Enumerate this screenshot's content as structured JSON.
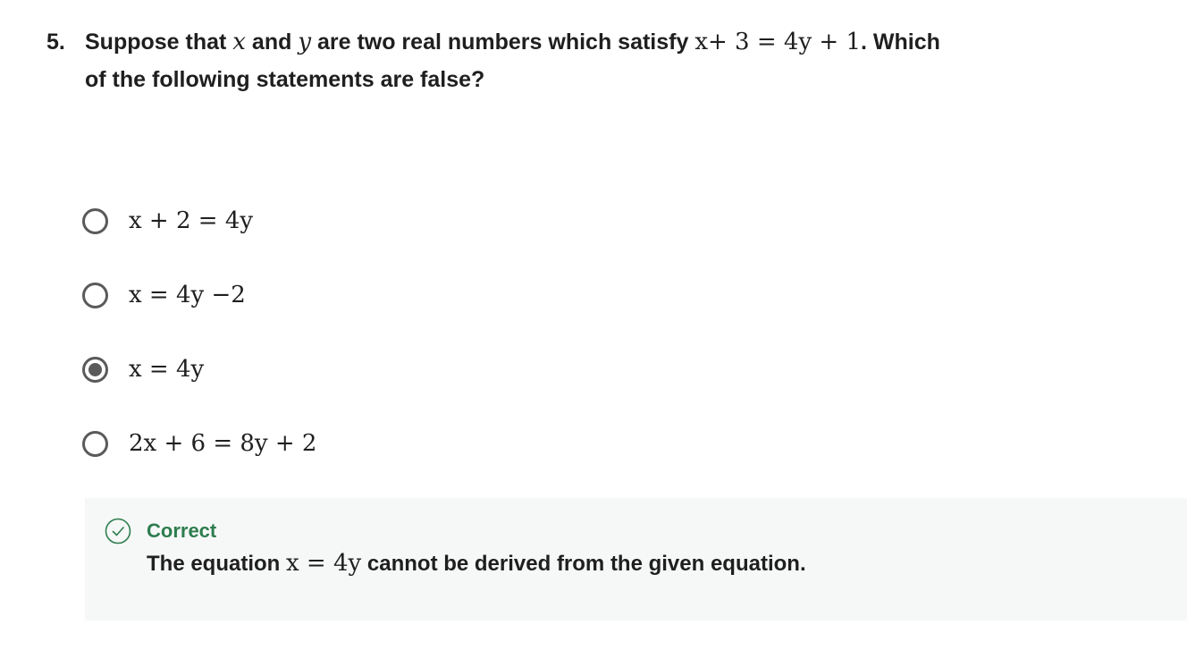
{
  "question": {
    "number": "5.",
    "text_part1": "Suppose that ",
    "var_x": "x",
    "text_part2": " and ",
    "var_y": "y",
    "text_part3": " are two real numbers which satisfy ",
    "equation": "x+ 3 = 4y + 1",
    "text_part4": ". Which of the following statements are false?"
  },
  "options": [
    {
      "label": "x + 2 = 4y",
      "selected": false
    },
    {
      "label": "x = 4y −2",
      "selected": false
    },
    {
      "label": "x = 4y",
      "selected": true
    },
    {
      "label": "2x + 6 = 8y + 2",
      "selected": false
    }
  ],
  "feedback": {
    "status": "Correct",
    "text_before": "The equation ",
    "equation": "x = 4y",
    "text_after": " cannot be derived from the given equation.",
    "icon": "check-circle-icon",
    "status_color": "#2e7d4f",
    "background_color": "#f6f8f7"
  }
}
